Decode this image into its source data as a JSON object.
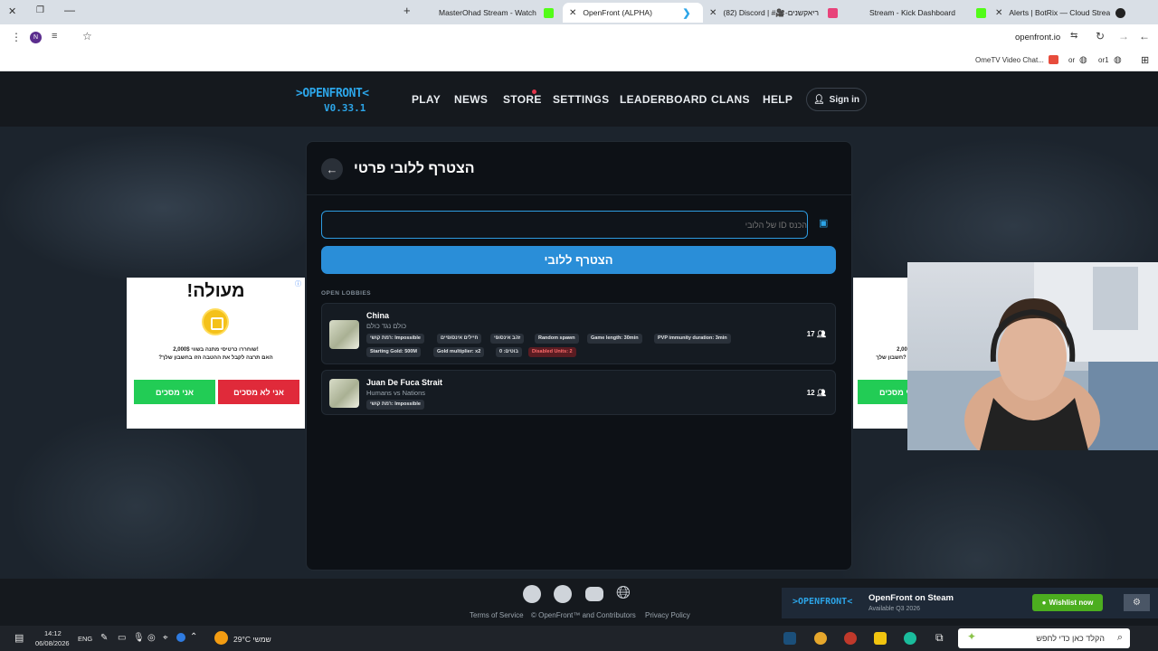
{
  "browser": {
    "tabs": [
      {
        "title": "MasterOhad Stream - Watch Li",
        "favicon_color": "#53fc18"
      },
      {
        "title": "OpenFront (ALPHA)",
        "favicon_color": "#2ca5e8"
      },
      {
        "title": "(82) Discord | #🎥-ריאקשנים",
        "favicon_color": "#5865f2"
      },
      {
        "title": "Stream - Kick Dashboard",
        "favicon_color": "#53fc18"
      },
      {
        "title": "Alerts | BotRix — Cloud Stream",
        "favicon_color": "#222222"
      }
    ],
    "address": "openfront.io",
    "profile_initial": "N",
    "bookmarks": [
      {
        "label": "OmeTV Video Chat..."
      },
      {
        "label": "or"
      },
      {
        "label": "or1"
      }
    ]
  },
  "site": {
    "logo_line1": ">OPENFRONT<",
    "logo_line2": "V0.33.1",
    "nav": [
      "PLAY",
      "NEWS",
      "STORE",
      "SETTINGS",
      "LEADERBOARD",
      "CLANS",
      "HELP"
    ],
    "signin": "Sign in"
  },
  "modal": {
    "title": "הצטרף ללובי פרטי",
    "input_placeholder": "הכנס ID של הלובי",
    "join_button": "הצטרף ללובי",
    "open_lobbies_label": "OPEN LOBBIES",
    "lobbies": [
      {
        "name": "China",
        "subtitle": "כולם נגד כולם",
        "count": "17",
        "tags_row1": [
          "רמת קושי: Impossible",
          "חיילים אינסופיים",
          "זהב אינסופי",
          "Random spawn",
          "Game length: 30min",
          "PVP immunity duration: 3min"
        ],
        "tags_row2": [
          "Starting Gold: 500M",
          "Gold multiplier: x2",
          "בוטים: 0"
        ],
        "alert_tag": "Disabled Units: 2"
      },
      {
        "name": "Juan De Fuca Strait",
        "subtitle": "Humans vs Nations",
        "count": "12",
        "tags_row1": [
          "רמת קושי: Impossible"
        ]
      }
    ]
  },
  "ads": {
    "title": "!מעולה",
    "line1": "שוחררו כרטיסי מתנה בשווי 2,000$!",
    "line2": "?האם תרצה לקבל את ההטבה הזו בחשבון שלך",
    "agree": "אני מסכים",
    "disagree": "אני לא מסכים",
    "right_line1": "2,00",
    "right_line2": "חשבון שלך?"
  },
  "footer": {
    "links": [
      "Terms of Service",
      "© OpenFront™ and Contributors",
      "Privacy Policy"
    ],
    "steam_logo": ">OPENFRONT<",
    "steam_title": "OpenFront on Steam",
    "steam_sub": "Available Q3 2026",
    "wishlist": "Wishlist now"
  },
  "taskbar": {
    "time": "14:12",
    "date": "06/08/2026",
    "lang": "ENG",
    "weather": "29°C שמשי",
    "search": "הקלד כאן כדי לחפש"
  }
}
